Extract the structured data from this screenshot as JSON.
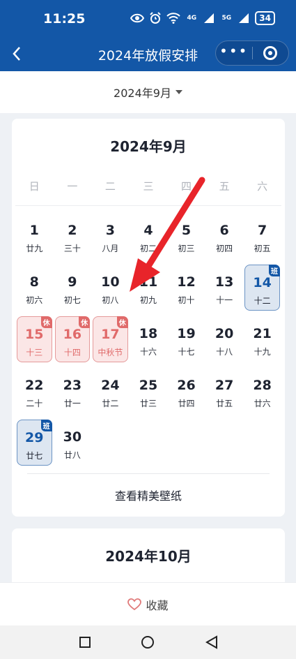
{
  "status": {
    "time": "11:25",
    "net1": "4G",
    "net2": "5G",
    "battery": "34"
  },
  "nav": {
    "title": "2024年放假安排"
  },
  "selector": {
    "month": "2024年9月"
  },
  "calendar": {
    "title": "2024年9月",
    "weekdays": [
      "日",
      "一",
      "二",
      "三",
      "四",
      "五",
      "六"
    ],
    "badges": {
      "rest": "休",
      "work": "班"
    },
    "days": [
      {
        "num": "1",
        "lunar": "廿九",
        "type": "normal",
        "col": 1
      },
      {
        "num": "2",
        "lunar": "三十",
        "type": "normal"
      },
      {
        "num": "3",
        "lunar": "八月",
        "type": "normal"
      },
      {
        "num": "4",
        "lunar": "初二",
        "type": "normal"
      },
      {
        "num": "5",
        "lunar": "初三",
        "type": "normal"
      },
      {
        "num": "6",
        "lunar": "初四",
        "type": "normal"
      },
      {
        "num": "7",
        "lunar": "初五",
        "type": "normal"
      },
      {
        "num": "8",
        "lunar": "初六",
        "type": "normal"
      },
      {
        "num": "9",
        "lunar": "初七",
        "type": "normal"
      },
      {
        "num": "10",
        "lunar": "初八",
        "type": "normal"
      },
      {
        "num": "11",
        "lunar": "初九",
        "type": "normal"
      },
      {
        "num": "12",
        "lunar": "初十",
        "type": "normal"
      },
      {
        "num": "13",
        "lunar": "十一",
        "type": "normal"
      },
      {
        "num": "14",
        "lunar": "十二",
        "type": "work"
      },
      {
        "num": "15",
        "lunar": "十三",
        "type": "rest"
      },
      {
        "num": "16",
        "lunar": "十四",
        "type": "rest"
      },
      {
        "num": "17",
        "lunar": "中秋节",
        "type": "rest"
      },
      {
        "num": "18",
        "lunar": "十六",
        "type": "normal"
      },
      {
        "num": "19",
        "lunar": "十七",
        "type": "normal"
      },
      {
        "num": "20",
        "lunar": "十八",
        "type": "normal"
      },
      {
        "num": "21",
        "lunar": "十九",
        "type": "normal"
      },
      {
        "num": "22",
        "lunar": "二十",
        "type": "normal"
      },
      {
        "num": "23",
        "lunar": "廿一",
        "type": "normal"
      },
      {
        "num": "24",
        "lunar": "廿二",
        "type": "normal"
      },
      {
        "num": "25",
        "lunar": "廿三",
        "type": "normal"
      },
      {
        "num": "26",
        "lunar": "廿四",
        "type": "normal"
      },
      {
        "num": "27",
        "lunar": "廿五",
        "type": "normal"
      },
      {
        "num": "28",
        "lunar": "廿六",
        "type": "normal"
      },
      {
        "num": "29",
        "lunar": "廿七",
        "type": "work"
      },
      {
        "num": "30",
        "lunar": "廿八",
        "type": "normal"
      }
    ],
    "wallpaper_link": "查看精美壁纸"
  },
  "next_card": {
    "title": "2024年10月"
  },
  "favorite": {
    "label": "收藏"
  },
  "colors": {
    "brand": "#1357a7",
    "rest": "#e06a6a",
    "arrow": "#e8242a"
  }
}
